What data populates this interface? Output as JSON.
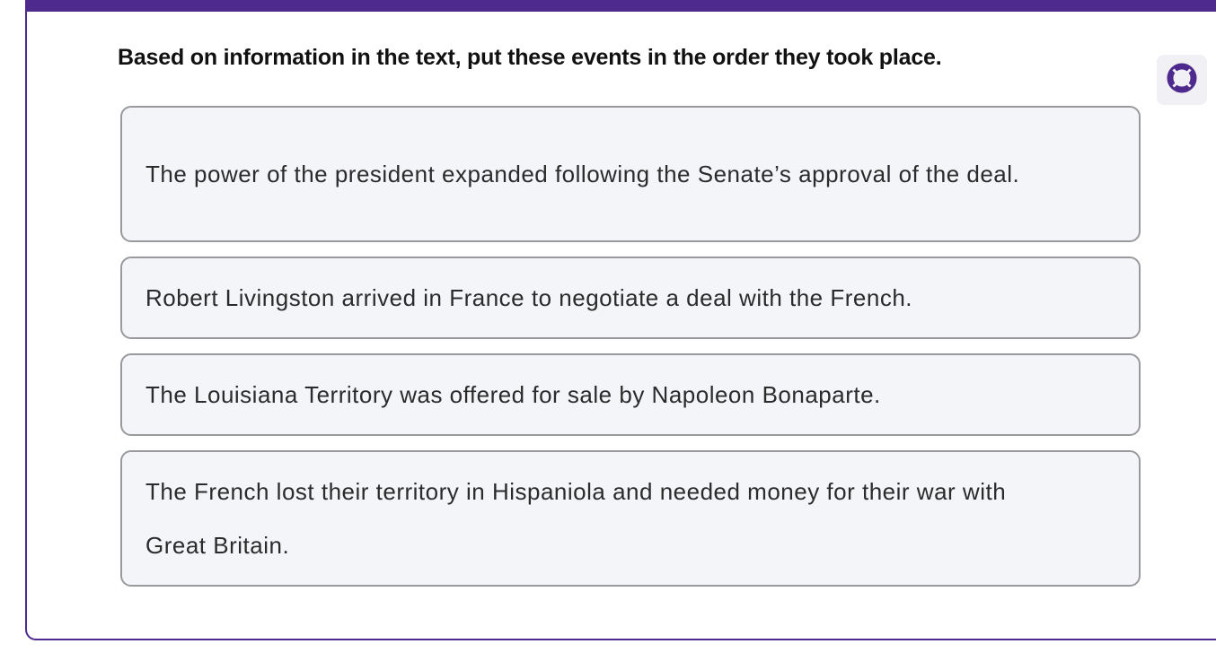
{
  "question": {
    "prompt": "Based on information in the text, put these events in the order they took place."
  },
  "help": {
    "icon": "lifebuoy-icon",
    "accent_color": "#4e2a8e"
  },
  "theme": {
    "accent": "#4e2a8e",
    "card_background": "#f4f5f9",
    "card_border": "#9a9a9e"
  },
  "events": [
    {
      "text": "The power of the president expanded following the Senate’s approval of the deal."
    },
    {
      "text": "Robert Livingston arrived in France to negotiate a deal with the French."
    },
    {
      "text": "The Louisiana Territory was offered for sale by Napoleon Bonaparte."
    },
    {
      "text": "The French lost their territory in Hispaniola and needed money for their war with Great Britain."
    }
  ]
}
